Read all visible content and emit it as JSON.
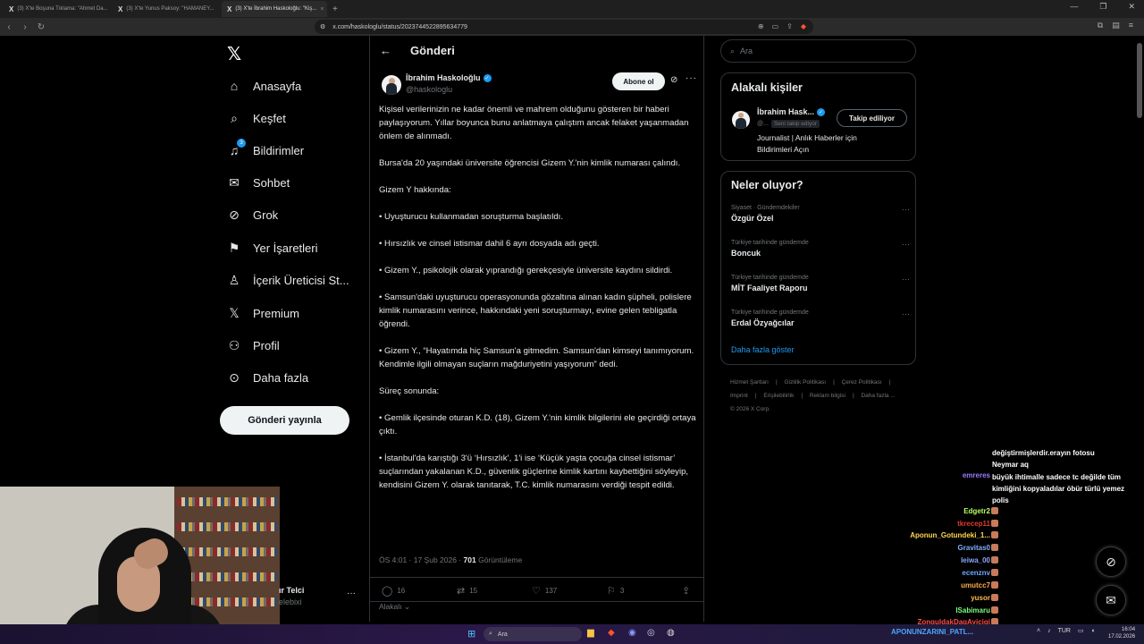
{
  "browser": {
    "tabs": [
      {
        "label": "(3) X'te Boşuna Tıklama: \"Ahmet Da...",
        "active": false
      },
      {
        "label": "(3) X'te Yunus Paksoy: \"HAMANEY...",
        "active": false
      },
      {
        "label": "(3) X'te İbrahim Haskoloğlu: \"Kiş...",
        "active": true
      }
    ],
    "url": "x.com/haskologlu/status/2023744522895634779"
  },
  "nav": {
    "items": [
      {
        "label": "Anasayfa",
        "icon": "home-icon",
        "glyph": "⌂"
      },
      {
        "label": "Keşfet",
        "icon": "search-icon",
        "glyph": "⌕"
      },
      {
        "label": "Bildirimler",
        "icon": "bell-icon",
        "glyph": "🔔",
        "badge": "3"
      },
      {
        "label": "Sohbet",
        "icon": "mail-icon",
        "glyph": "✉"
      },
      {
        "label": "Grok",
        "icon": "grok-icon",
        "glyph": "⊘"
      },
      {
        "label": "Yer İşaretleri",
        "icon": "bookmark-icon",
        "glyph": "⚑"
      },
      {
        "label": "İçerik Üreticisi St...",
        "icon": "creator-studio-icon",
        "glyph": "♙"
      },
      {
        "label": "Premium",
        "icon": "x-premium-icon",
        "glyph": "𝕏"
      },
      {
        "label": "Profil",
        "icon": "profile-icon",
        "glyph": "⚇"
      },
      {
        "label": "Daha fazla",
        "icon": "more-circle-icon",
        "glyph": "⋯"
      }
    ],
    "post_button": "Gönderi yayınla"
  },
  "account": {
    "name": "ır Telci",
    "handle": "elebixi"
  },
  "header": {
    "title": "Gönderi"
  },
  "tweet": {
    "author": "İbrahim Haskoloğlu",
    "handle": "@haskologlu",
    "subscribe": "Abone ol",
    "paragraphs": [
      "Kişisel verilerinizin ne kadar önemli ve mahrem olduğunu gösteren bir haberi paylaşıyorum. Yıllar boyunca bunu anlatmaya çalıştım ancak felaket yaşanmadan önlem de alınmadı.",
      "Bursa'da 20 yaşındaki üniversite öğrencisi Gizem Y.'nin kimlik numarası çalındı.",
      "Gizem Y hakkında:",
      "• Uyuşturucu kullanmadan soruşturma başlatıldı.",
      "• Hırsızlık ve cinsel istismar dahil 6 ayrı dosyada adı geçti.",
      "• Gizem Y., psikolojik olarak yıprandığı gerekçesiyle üniversite kaydını sildirdi.",
      "• Samsun'daki uyuşturucu operasyonunda gözaltına alınan kadın şüpheli, polislere kimlik numarasını verince, hakkındaki yeni soruşturmayı, evine gelen tebligatla öğrendi.",
      "• Gizem Y., “Hayatımda hiç Samsun'a gitmedim. Samsun'dan kimseyi tanımıyorum. Kendimle ilgili olmayan suçların mağduriyetini yaşıyorum” dedi.",
      "Süreç sonunda:",
      "• Gemlik ilçesinde oturan K.D. (18), Gizem Y.'nin kimlik bilgilerini ele geçirdiği ortaya çıktı.",
      "• İstanbul'da karıştığı 3'ü ‘Hırsızlık’, 1'i ise ‘Küçük yaşta çocuğa cinsel istismar’ suçlarından yakalanan K.D., güvenlik güçlerine kimlik kartını kaybettiğini söyleyip, kendisini Gizem Y. olarak tanıtarak, T.C. kimlik numarasını verdiği tespit edildi."
    ],
    "time": "ÖS 4:01 · 17 Şub 2026 ·",
    "views": "701",
    "views_label": "Görüntüleme",
    "replies": "16",
    "reposts": "15",
    "likes": "137",
    "bookmarks": "3",
    "related": "Alakalı"
  },
  "right": {
    "search_placeholder": "Ara",
    "related_title": "Alakalı kişiler",
    "related_person": {
      "name": "İbrahim Hask...",
      "handle": "@...",
      "follows_you": "Seni takip ediyor",
      "follow_button": "Takip ediliyor",
      "bio": "Journalist | Anlık Haberler için Bildirimleri Açın"
    },
    "trends_title": "Neler oluyor?",
    "trends": [
      {
        "context": "Siyaset · Gündemdekiler",
        "name": "Özgür Özel"
      },
      {
        "context": "Türkiye tarihinde gündemde",
        "name": "Boncuk"
      },
      {
        "context": "Türkiye tarihinde gündemde",
        "name": "MİT Faaliyet Raporu"
      },
      {
        "context": "Türkiye tarihinde gündemde",
        "name": "Erdal Özyağcılar"
      }
    ],
    "show_more": "Daha fazla göster",
    "footer": [
      "Hizmet Şartları",
      "Gizlilik Politikası",
      "Çerez Politikası",
      "Imprint",
      "Erişilebilirlik",
      "Reklam bilgisi",
      "Daha fazla ...",
      "© 2026 X Corp."
    ]
  },
  "chat": {
    "lines": [
      {
        "user": "",
        "color": "#ffffff",
        "msg": "değiştirmişlerdir.erayın fotosu"
      },
      {
        "user": "",
        "color": "#ffffff",
        "msg": "Neymar aq"
      },
      {
        "user": "emreres",
        "color": "#9b7bff",
        "msg": "büyük ihtimalle sadece tc değilde tüm kimliğini kopyaladılar öbür türlü yemez polis"
      },
      {
        "user": "Edgetr2",
        "color": "#b8ff5c",
        "msg": ""
      },
      {
        "user": "tkrecep11",
        "color": "#e0392b",
        "msg": ""
      },
      {
        "user": "Aponun_Gotundeki_1...",
        "color": "#ffd84d",
        "msg": ""
      },
      {
        "user": "Gravitas0",
        "color": "#7fb2ff",
        "msg": ""
      },
      {
        "user": "leiwa_00",
        "color": "#8aa8ff",
        "msg": ""
      },
      {
        "user": "ecenznv",
        "color": "#6ea8ff",
        "msg": ""
      },
      {
        "user": "umutcc7",
        "color": "#ffa94d",
        "msg": ""
      },
      {
        "user": "yusor",
        "color": "#ffb84d",
        "msg": ""
      },
      {
        "user": "ISabimaru",
        "color": "#7dff7d",
        "msg": ""
      },
      {
        "user": "ZonguldakDagAyicigi",
        "color": "#ff4d4d",
        "msg": ""
      }
    ]
  },
  "taskbar": {
    "search": "Ara",
    "banner": "APONUNZARINI_PATL...",
    "lang": "TUR",
    "time": "16:04",
    "date": "17.02.2026"
  }
}
